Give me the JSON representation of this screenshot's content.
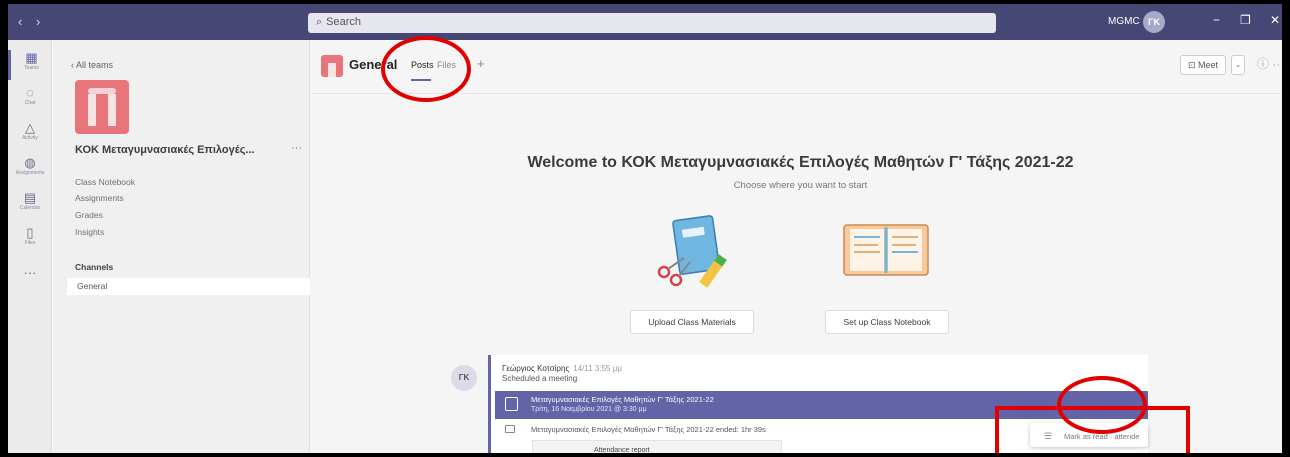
{
  "titlebar": {
    "back_icon": "chevron-left-icon",
    "forward_icon": "chevron-right-icon",
    "search_placeholder": "Search",
    "org_label": "MGMC",
    "avatar_initials": "ΓΚ",
    "min_icon": "minimize-icon",
    "max_icon": "maximize-icon",
    "close_icon": "close-icon"
  },
  "rail": [
    {
      "label": "Teams",
      "icon": "teams-icon",
      "glyph": "▦"
    },
    {
      "label": "Chat",
      "icon": "chat-icon",
      "glyph": "◌"
    },
    {
      "label": "Activity",
      "icon": "bell-icon",
      "glyph": "△"
    },
    {
      "label": "Assignments",
      "icon": "assignments-icon",
      "glyph": "◍"
    },
    {
      "label": "Calendar",
      "icon": "calendar-icon",
      "glyph": "▤"
    },
    {
      "label": "Files",
      "icon": "file-icon",
      "glyph": "▯"
    },
    {
      "label": "",
      "icon": "more-apps-icon",
      "glyph": "···"
    }
  ],
  "sidebar": {
    "all_teams": "‹  All teams",
    "team_name": "ΚΟΚ Μεταγυμνασιακές Επιλογές...",
    "more": "···",
    "links": [
      "Class Notebook",
      "Assignments",
      "Grades",
      "Insights"
    ],
    "channels_header": "Channels",
    "channel_general": "General"
  },
  "channel": {
    "name": "General",
    "tab_posts": "Posts",
    "tab_files": "Files",
    "add_tab": "+",
    "meet_label": "⊡ Meet",
    "meet_caret": "⌄",
    "info": "ⓘ ···"
  },
  "welcome": {
    "title": "Welcome to ΚΟΚ Μεταγυμνασιακές Επιλογές Μαθητών Γ' Τάξης 2021-22",
    "subtitle": "Choose where you want to start",
    "upload_button": "Upload Class Materials",
    "notebook_button": "Set up Class Notebook"
  },
  "post": {
    "avatar_initials": "ΓΚ",
    "author": "Γεώργιος Κοτσίρης",
    "time": "14/11 3:55 μμ",
    "action": "Scheduled a meeting",
    "meeting_title": "Μεταγυμνασιακές Επιλογές Μαθητών Γ' Τάξης 2021-22",
    "meeting_date": "Τρίτη, 16 Νοεμβρίου 2021 @ 3:30 μμ",
    "ended_text": "Μεταγυμνασιακές Επιλογές Μαθητών Γ' Τάξης 2021-22 ended: 1hr 39s",
    "attendance_label": "Attendance report"
  },
  "context_menu": {
    "icon": "list-icon",
    "label": "Mark as read · attende"
  },
  "colors": {
    "titlebar": "#464775",
    "accent": "#6264a7",
    "team_tile": "#e8757a",
    "annotation": "#e10000"
  }
}
